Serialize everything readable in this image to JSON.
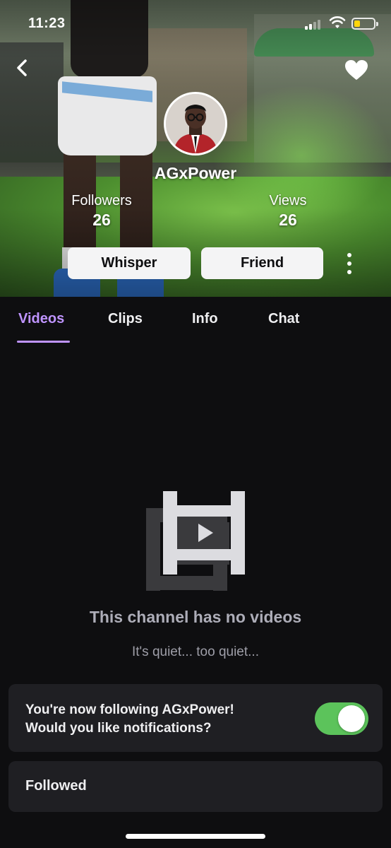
{
  "status_bar": {
    "time": "11:23"
  },
  "profile": {
    "username": "AGxPower",
    "stats": [
      {
        "label": "Followers",
        "value": "26"
      },
      {
        "label": "Views",
        "value": "26"
      }
    ],
    "actions": {
      "whisper_label": "Whisper",
      "friend_label": "Friend"
    }
  },
  "tabs": [
    {
      "label": "Videos",
      "active": true
    },
    {
      "label": "Clips",
      "active": false
    },
    {
      "label": "Info",
      "active": false
    },
    {
      "label": "Chat",
      "active": false
    }
  ],
  "empty_state": {
    "title": "This channel has no videos",
    "subtitle": "It's quiet... too quiet..."
  },
  "notification_card": {
    "line1": "You're now following AGxPower!",
    "line2": "Would you like notifications?",
    "toggle_on": true
  },
  "followed_card": {
    "label": "Followed"
  },
  "colors": {
    "accent": "#bf94ff",
    "background": "#0e0e10",
    "card": "#1f1f23",
    "toggle_on": "#5cc35b"
  },
  "icons": [
    "back-chevron-icon",
    "heart-icon",
    "more-vertical-icon",
    "video-placeholder-icon",
    "wifi-icon",
    "battery-icon",
    "cellular-signal-icon"
  ]
}
